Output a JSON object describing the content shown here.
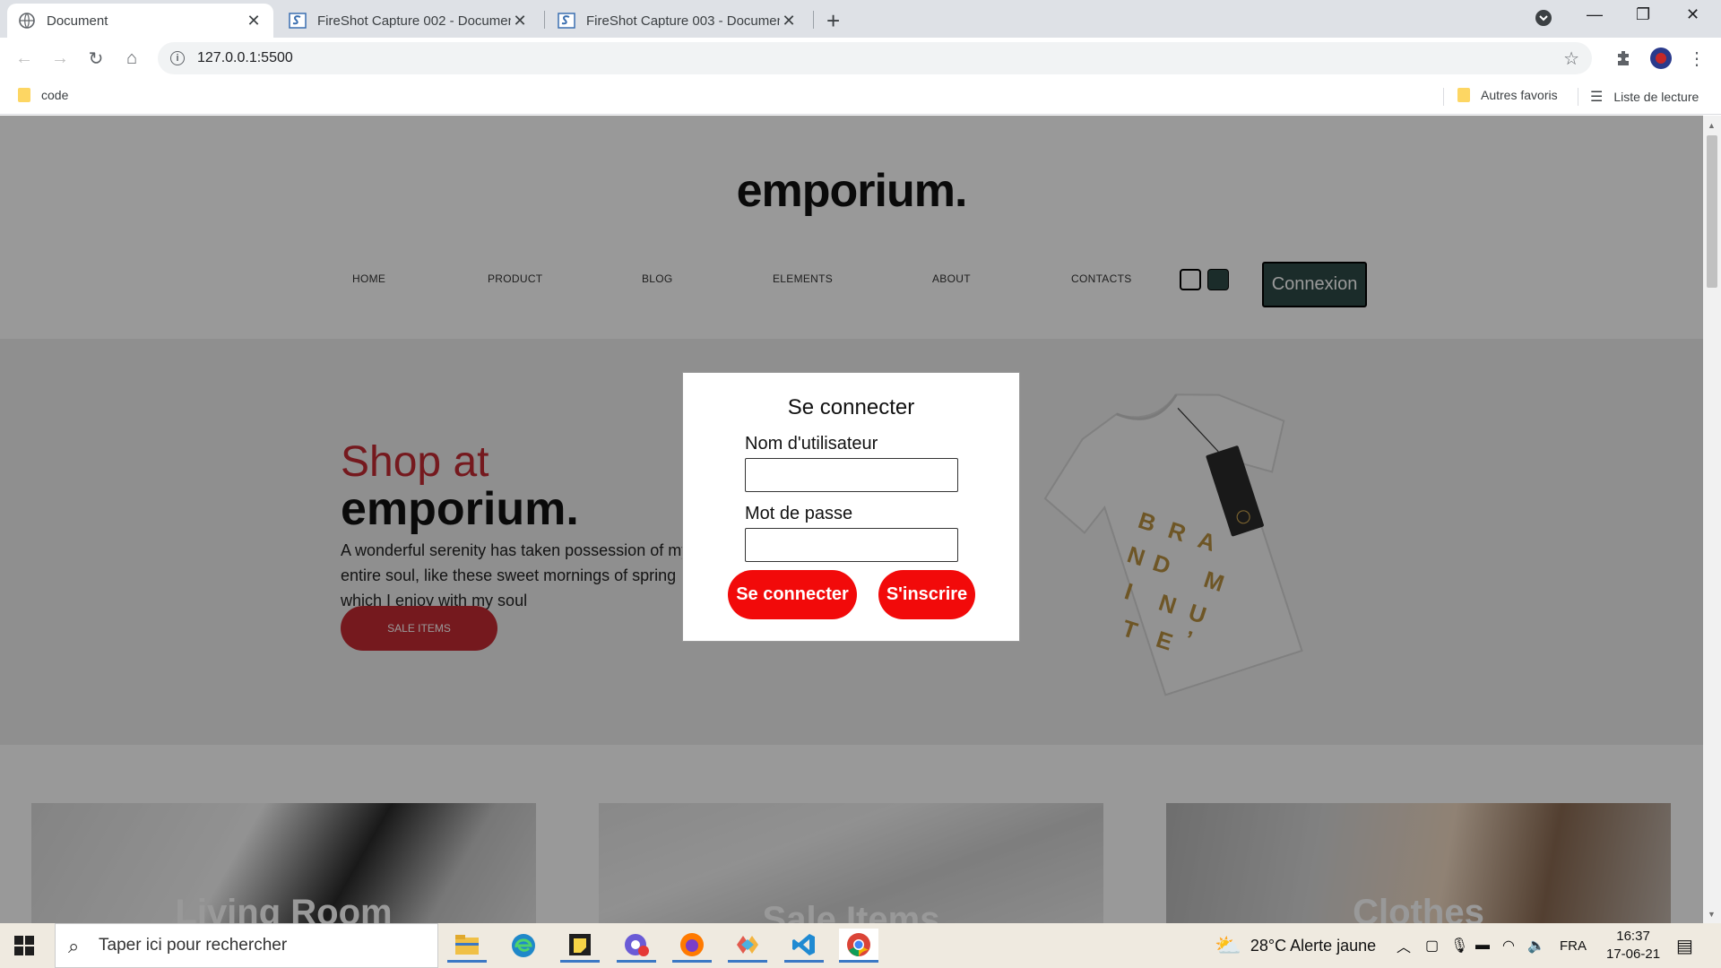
{
  "browser": {
    "tabs": [
      {
        "title": "Document",
        "active": true
      },
      {
        "title": "FireShot Capture 002 - Documen",
        "active": false
      },
      {
        "title": "FireShot Capture 003 - Documen",
        "active": false
      }
    ],
    "url": "127.0.0.1:5500",
    "bookmarks": {
      "left": "code",
      "right1": "Autres favoris",
      "right2": "Liste de lecture"
    }
  },
  "site": {
    "logo": "emporium.",
    "nav": [
      "HOME",
      "PRODUCT",
      "BLOG",
      "ELEMENTS",
      "ABOUT",
      "CONTACTS"
    ],
    "connexion_label": "Connexion",
    "swatch_colors": [
      "#ffffff",
      "#2e4a47"
    ],
    "hero": {
      "title_line1": "Shop at",
      "title_line2": "emporium.",
      "text": "A wonderful serenity has taken possession of my entire soul, like these sweet mornings of spring which I enjoy with my soul",
      "button": "SALE ITEMS",
      "tshirt_print": [
        "B",
        "R",
        "A",
        "N",
        "D",
        "M",
        "I",
        "N",
        "U",
        "T",
        "E",
        "’"
      ]
    },
    "cards": [
      {
        "label": "Living Room"
      },
      {
        "label": "Sale Items"
      },
      {
        "label": "Clothes"
      }
    ],
    "accent_color": "#c32b33"
  },
  "modal": {
    "title": "Se connecter",
    "username_label": "Nom d'utilisateur",
    "password_label": "Mot de passe",
    "username_value": "",
    "password_value": "",
    "login_button": "Se connecter",
    "signup_button": "S'inscrire",
    "button_color": "#f20a0a"
  },
  "taskbar": {
    "search_placeholder": "Taper ici pour rechercher",
    "weather": "28°C  Alerte jaune",
    "language": "FRA",
    "time": "16:37",
    "date": "17-06-21"
  }
}
